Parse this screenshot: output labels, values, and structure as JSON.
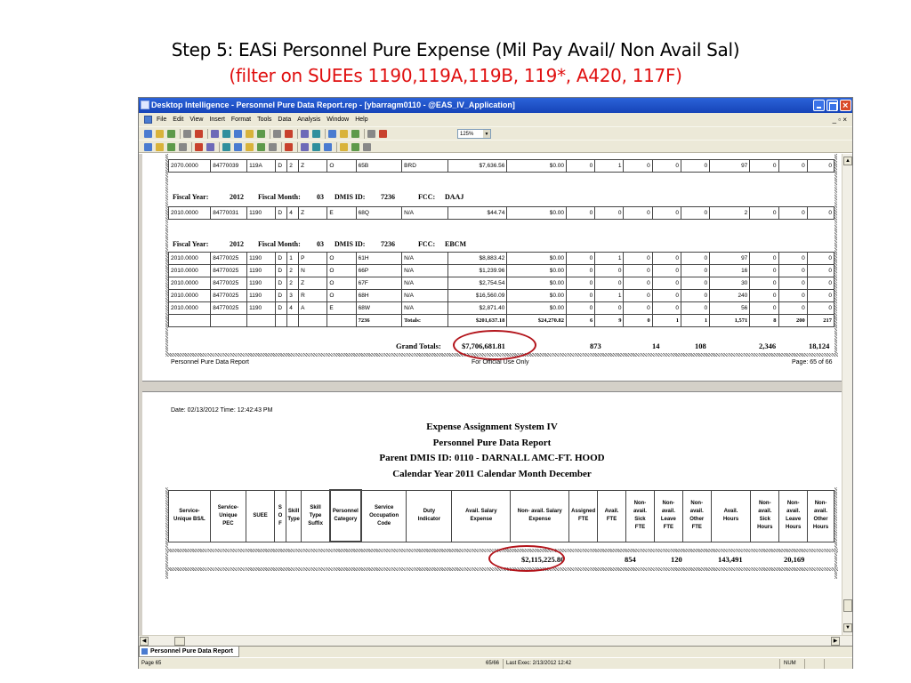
{
  "slide": {
    "title_line1": "Step 5: EASi Personnel Pure Expense (Mil Pay Avail/ Non Avail Sal)",
    "title_line2": "(filter on SUEEs 1190,119A,119B, 119*, A420, 117F)",
    "title_line2_color": "#e01010",
    "highlight_color": "#b3141b"
  },
  "window": {
    "title": "Desktop Intelligence - Personnel Pure Data Report.rep - [ybarragm0110 - @EAS_IV_Application]",
    "menu": [
      "File",
      "Edit",
      "View",
      "Insert",
      "Format",
      "Tools",
      "Data",
      "Analysis",
      "Window",
      "Help"
    ],
    "mdi_controls": "_ ▫ ×",
    "zoom": "125%",
    "toolbar1_icons": [
      "new-icon",
      "open-icon",
      "save-icon",
      "print-icon",
      "preview-icon",
      "cut-icon",
      "copy-icon",
      "paste-icon",
      "format-painter-icon",
      "delete-icon",
      "find-icon",
      "undo-icon",
      "redo-icon",
      "refresh-icon",
      "query-icon",
      "drill-icon",
      "slice-icon",
      "pivot-icon",
      "zoom-icon"
    ],
    "toolbar2_icons": [
      "table-icon",
      "crosstab-icon",
      "chart-icon",
      "sort-icon",
      "filter-icon",
      "rank-icon",
      "sum-icon",
      "calculation-icon",
      "variable-icon",
      "break-icon",
      "alert-icon",
      "warning-icon",
      "insert-cell-icon",
      "insert-picture-icon",
      "chart-type-icon",
      "outline-icon",
      "drill-filter-icon",
      "report-manager-icon"
    ]
  },
  "report_upper": {
    "rows_top": [
      [
        "2070.0000",
        "84770039",
        "119A",
        "D",
        "2",
        "Z",
        "O",
        "65B",
        "BRD",
        "$7,636.56",
        "$0.00",
        "0",
        "1",
        "0",
        "0",
        "0",
        "97",
        "0",
        "0",
        "0"
      ]
    ],
    "fy_daaj": {
      "fy_label": "Fiscal Year:",
      "fy": "2012",
      "fm_label": "Fiscal Month:",
      "fm": "03",
      "dmis_label": "DMIS ID:",
      "dmis": "7236",
      "fcc_label": "FCC:",
      "fcc": "DAAJ"
    },
    "rows_daaj": [
      [
        "2010.0000",
        "84770031",
        "1190",
        "D",
        "4",
        "Z",
        "E",
        "68Q",
        "N/A",
        "$44.74",
        "$0.00",
        "0",
        "0",
        "0",
        "0",
        "0",
        "2",
        "0",
        "0",
        "0"
      ]
    ],
    "fy_ebcm": {
      "fy_label": "Fiscal Year:",
      "fy": "2012",
      "fm_label": "Fiscal Month:",
      "fm": "03",
      "dmis_label": "DMIS ID:",
      "dmis": "7236",
      "fcc_label": "FCC:",
      "fcc": "EBCM"
    },
    "rows_ebcm": [
      [
        "2010.0000",
        "84770025",
        "1190",
        "D",
        "1",
        "P",
        "O",
        "61H",
        "N/A",
        "$8,883.42",
        "$0.00",
        "0",
        "1",
        "0",
        "0",
        "0",
        "97",
        "0",
        "0",
        "0"
      ],
      [
        "2010.0000",
        "84770025",
        "1190",
        "D",
        "2",
        "N",
        "O",
        "66P",
        "N/A",
        "$1,239.96",
        "$0.00",
        "0",
        "0",
        "0",
        "0",
        "0",
        "16",
        "0",
        "0",
        "0"
      ],
      [
        "2010.0000",
        "84770025",
        "1190",
        "D",
        "2",
        "Z",
        "O",
        "67F",
        "N/A",
        "$2,754.54",
        "$0.00",
        "0",
        "0",
        "0",
        "0",
        "0",
        "30",
        "0",
        "0",
        "0"
      ],
      [
        "2010.0000",
        "84770025",
        "1190",
        "D",
        "3",
        "R",
        "O",
        "68H",
        "N/A",
        "$16,560.09",
        "$0.00",
        "0",
        "1",
        "0",
        "0",
        "0",
        "240",
        "0",
        "0",
        "0"
      ],
      [
        "2010.0000",
        "84770025",
        "1190",
        "D",
        "4",
        "A",
        "E",
        "68W",
        "N/A",
        "$2,871.40",
        "$0.00",
        "0",
        "0",
        "0",
        "0",
        "0",
        "56",
        "0",
        "0",
        "0"
      ]
    ],
    "totals_row": [
      "",
      "",
      "",
      "",
      "",
      "",
      "",
      "7236",
      "Totals:",
      "$201,637.18",
      "$24,270.82",
      "6",
      "9",
      "0",
      "1",
      "1",
      "1,571",
      "8",
      "200",
      "217"
    ],
    "grand_totals": {
      "label": "Grand Totals:",
      "salary": "$7,706,681.81",
      "fte": "873",
      "c2": "14",
      "c3": "108",
      "c4": "2,346",
      "c5": "18,124"
    },
    "footer_left": "Personnel Pure Data Report",
    "footer_center": "For Official Use Only",
    "footer_right": "Page: 65 of 66"
  },
  "report_lower": {
    "date_line": "Date:   02/13/2012 Time:  12:42:43 PM",
    "title1": "Expense Assignment System IV",
    "title2": "Personnel Pure Data Report",
    "title3": "Parent DMIS ID: 0110 - DARNALL AMC-FT. HOOD",
    "title4": "Calendar Year 2011   Calendar Month   December",
    "headers": [
      "Service-\nUnique BS/L",
      "Service-\nUnique\nPEC",
      "SUEE",
      "S\nO\nF",
      "Skill\nType",
      "Skill\nType\nSuffix",
      "Personnel\nCategory",
      "Service\nOccupation\nCode",
      "Duty\nIndicator",
      "Avail. Salary\nExpense",
      "Non- avail. Salary\nExpense",
      "Assigned\nFTE",
      "Avail.\nFTE",
      "Non-\navail.\nSick\nFTE",
      "Non-\navail.\nLeave\nFTE",
      "Non-\navail.\nOther\nFTE",
      "Avail.\nHours",
      "Non-\navail.\nSick\nHours",
      "Non-\navail.\nLeave\nHours",
      "Non-\navail.\nOther\nHours"
    ],
    "totals": {
      "salary": "$2,115,225.80",
      "fte": "854",
      "c2": "120",
      "c3": "143,491",
      "c4": "20,169"
    }
  },
  "tab": {
    "label": "Personnel Pure Data Report"
  },
  "status": {
    "page": "Page 65",
    "pages": "65/66",
    "last_exec": "Last Exec: 2/13/2012 12:42",
    "num": "NUM"
  }
}
